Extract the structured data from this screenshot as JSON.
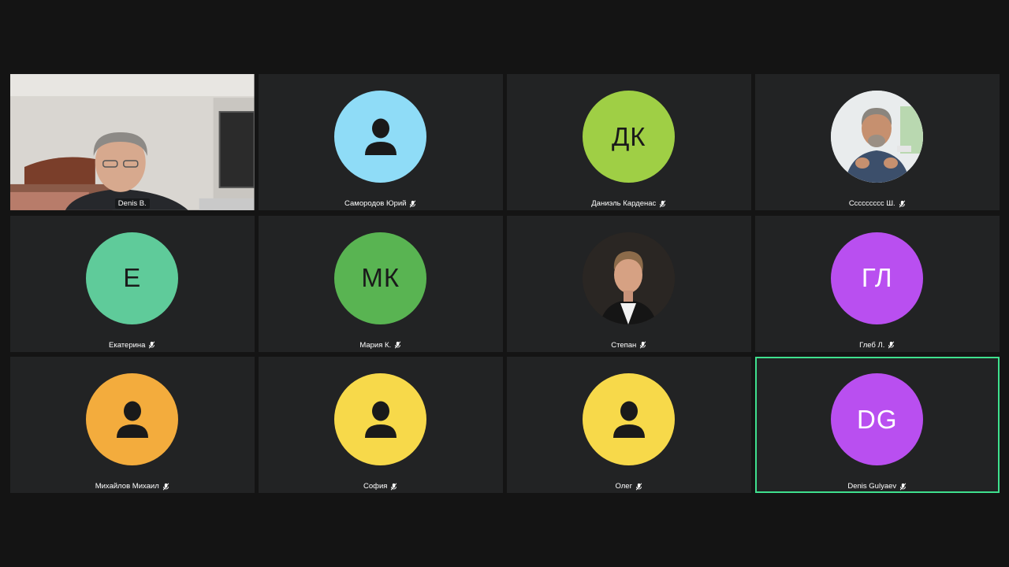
{
  "colors": {
    "background": "#141414",
    "tile": "#222324",
    "active_border": "#3fe08e"
  },
  "participants": [
    {
      "name": "Denis B.",
      "type": "video"
    },
    {
      "name": "Самородов Юрий",
      "type": "icon",
      "color": "#8fdcf7",
      "icon": "person-icon"
    },
    {
      "name": "Даниэль Карденас",
      "type": "initials",
      "initials": "ДК",
      "color": "#9fcf45"
    },
    {
      "name": "Ссссссссс Ш.",
      "type": "photo",
      "color": "#dfe6e8"
    },
    {
      "name": "Екатерина",
      "type": "initials",
      "initials": "Е",
      "color": "#5fcb9a"
    },
    {
      "name": "Мария К.",
      "type": "initials",
      "initials": "МК",
      "color": "#59b452"
    },
    {
      "name": "Степан",
      "type": "photo",
      "color": "#2a2623"
    },
    {
      "name": "Глеб Л.",
      "type": "initials",
      "initials": "ГЛ",
      "color": "#b94ff0"
    },
    {
      "name": "Михайлов Михаил",
      "type": "icon",
      "color": "#f3ac3d",
      "icon": "person-icon"
    },
    {
      "name": "София",
      "type": "icon",
      "color": "#f7d94a",
      "icon": "person-icon"
    },
    {
      "name": "Олег",
      "type": "icon",
      "color": "#f7d94a",
      "icon": "person-icon"
    },
    {
      "name": "Denis Gulyaev",
      "type": "initials",
      "initials": "DG",
      "color": "#b94ff0",
      "active": true
    }
  ]
}
